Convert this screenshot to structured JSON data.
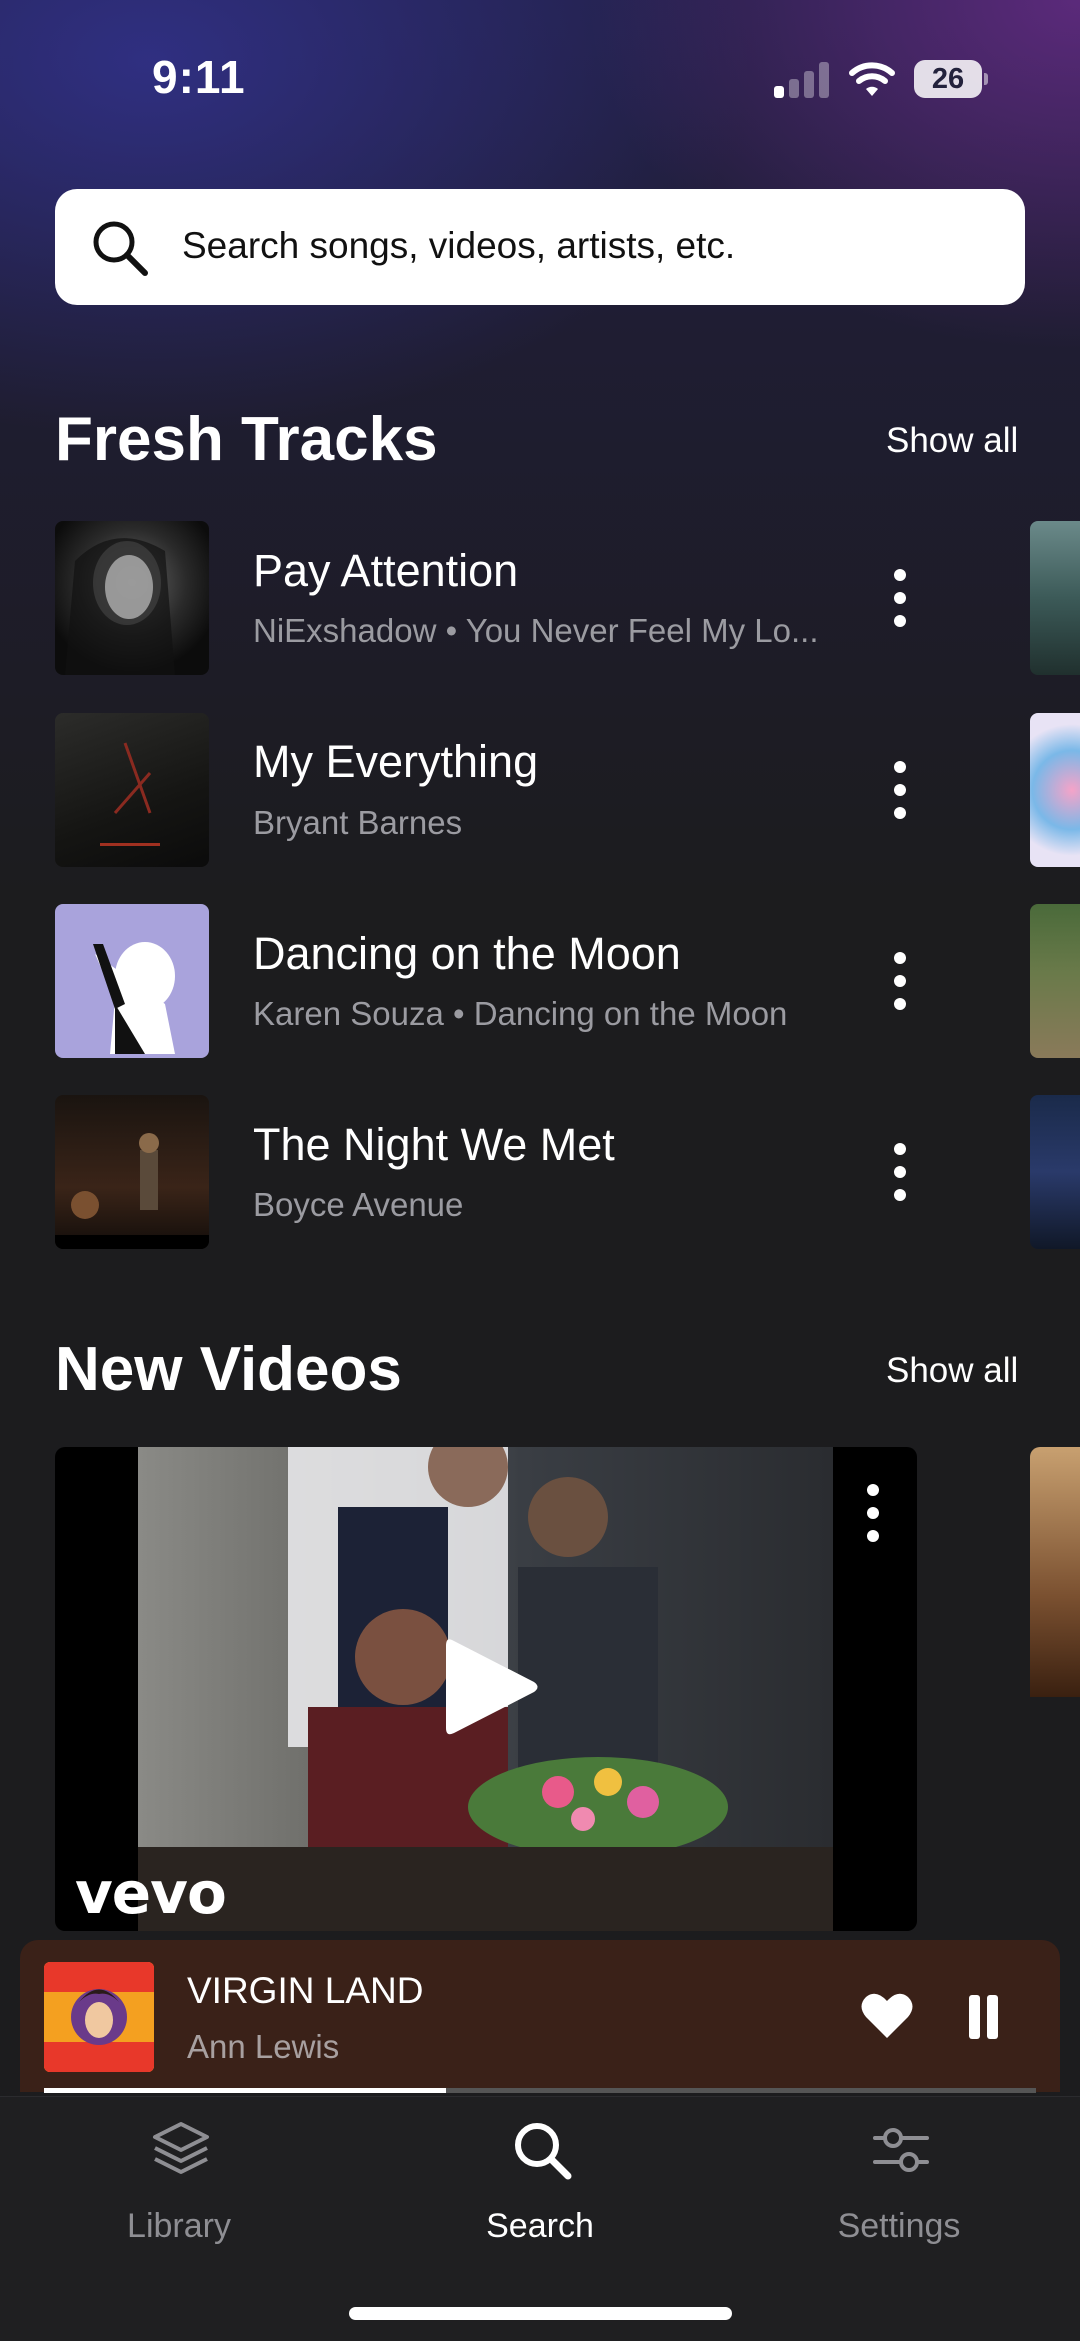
{
  "status_bar": {
    "time": "9:11",
    "battery": "26"
  },
  "search": {
    "placeholder": "Search songs, videos, artists, etc."
  },
  "fresh_tracks": {
    "title": "Fresh Tracks",
    "show_all": "Show all",
    "items": [
      {
        "title": "Pay Attention",
        "subtitle": "NiExshadow • You Never Feel My Lo..."
      },
      {
        "title": "My Everything",
        "subtitle": "Bryant Barnes"
      },
      {
        "title": "Dancing on the Moon",
        "subtitle": "Karen Souza • Dancing on the Moon"
      },
      {
        "title": "The Night We Met",
        "subtitle": "Boyce Avenue"
      }
    ]
  },
  "new_videos": {
    "title": "New Videos",
    "show_all": "Show all",
    "video_brand": "vevo"
  },
  "now_playing": {
    "title": "VIRGIN LAND",
    "artist": "Ann Lewis",
    "progress_fraction": 0.405
  },
  "tabs": [
    {
      "label": "Library",
      "icon": "layers-icon",
      "active": false
    },
    {
      "label": "Search",
      "icon": "search-icon",
      "active": true
    },
    {
      "label": "Settings",
      "icon": "sliders-icon",
      "active": false
    }
  ]
}
